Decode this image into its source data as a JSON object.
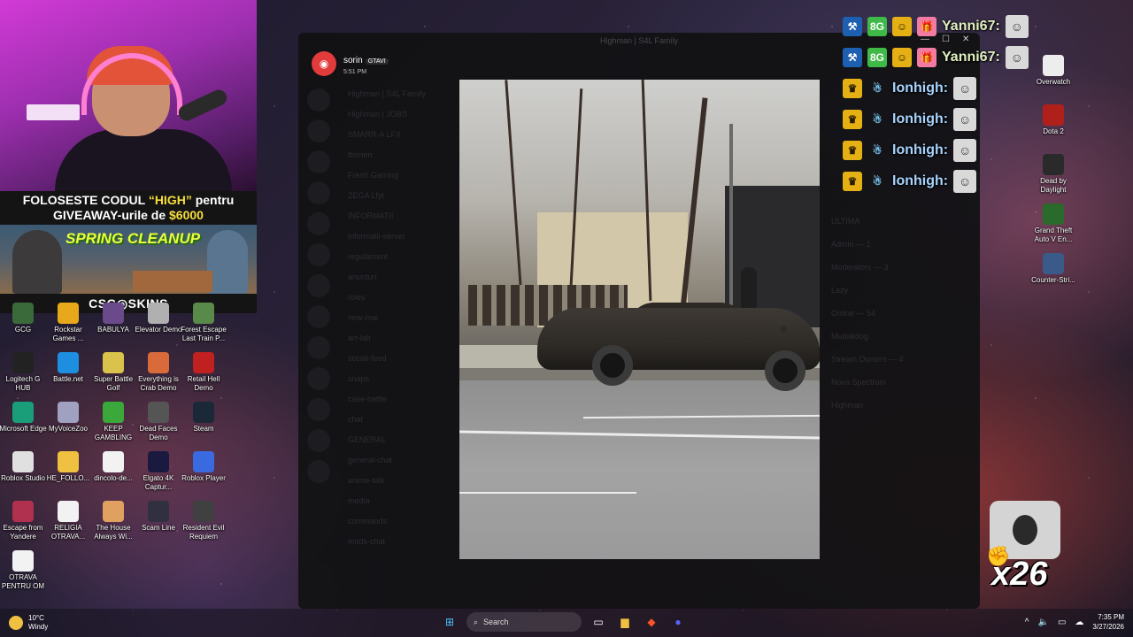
{
  "stream": {
    "promo_line1_a": "FOLOSESTE CODUL ",
    "promo_code": "“HIGH”",
    "promo_line1_b": " pentru",
    "promo_line2_a": "GIVEAWAY-urile de ",
    "promo_amount": "$6000",
    "game_banner": "SPRING CLEANUP",
    "sponsor": "CSG◎SKINS"
  },
  "desktop_left": [
    {
      "label": "GCG",
      "icon": "app-icon",
      "color": "#3a6a3a"
    },
    {
      "label": "Rockstar Games ...",
      "icon": "rockstar-icon",
      "color": "#e8a81b"
    },
    {
      "label": "BABULYA",
      "icon": "app-icon",
      "color": "#6a4a8a"
    },
    {
      "label": "Elevator Demo",
      "icon": "game-icon",
      "color": "#b0b0b0"
    },
    {
      "label": "Forest Escape Last Train P...",
      "icon": "game-icon",
      "color": "#5a8a4a"
    },
    {
      "label": "Logitech G HUB",
      "icon": "logitech-icon",
      "color": "#222222"
    },
    {
      "label": "Battle.net",
      "icon": "battlenet-icon",
      "color": "#1e8ee0"
    },
    {
      "label": "Super Battle Golf",
      "icon": "game-icon",
      "color": "#d9c34a"
    },
    {
      "label": "Everything is Crab Demo",
      "icon": "game-icon",
      "color": "#d96a3a"
    },
    {
      "label": "Retail Hell Demo",
      "icon": "game-icon",
      "color": "#c02020"
    },
    {
      "label": "Microsoft Edge",
      "icon": "edge-icon",
      "color": "#1a9e7a"
    },
    {
      "label": "MyVoiceZoo",
      "icon": "app-icon",
      "color": "#a0a0c0"
    },
    {
      "label": "KEEP GAMBLING",
      "icon": "dollar-icon",
      "color": "#3aa83a"
    },
    {
      "label": "Dead Faces Demo",
      "icon": "game-icon",
      "color": "#555555"
    },
    {
      "label": "Steam",
      "icon": "steam-icon",
      "color": "#1b2838"
    },
    {
      "label": "Roblox Studio",
      "icon": "roblox-icon",
      "color": "#e0e0e0"
    },
    {
      "label": "HE_FOLLO...",
      "icon": "folder-icon",
      "color": "#f0c040"
    },
    {
      "label": "dincolo-de...",
      "icon": "document-icon",
      "color": "#f2f2f2"
    },
    {
      "label": "Elgato 4K Captur...",
      "icon": "elgato-icon",
      "color": "#1a1a40"
    },
    {
      "label": "Roblox Player",
      "icon": "roblox-icon",
      "color": "#3a6ae0"
    },
    {
      "label": "Escape from Yandere",
      "icon": "game-icon",
      "color": "#b03050"
    },
    {
      "label": "RELIGIA OTRAVA...",
      "icon": "document-icon",
      "color": "#f2f2f2"
    },
    {
      "label": "The House Always Wi...",
      "icon": "game-icon",
      "color": "#e0a060"
    },
    {
      "label": "Scam Line",
      "icon": "game-icon",
      "color": "#303040"
    },
    {
      "label": "Resident Evil Requiem",
      "icon": "game-icon",
      "color": "#404040"
    },
    {
      "label": "OTRAVA PENTRU OM",
      "icon": "document-icon",
      "color": "#f2f2f2"
    }
  ],
  "desktop_right": [
    {
      "label": "Overwatch",
      "icon": "overwatch-icon",
      "color": "#ededed"
    },
    {
      "label": "Dota 2",
      "icon": "dota-icon",
      "color": "#b0201a"
    },
    {
      "label": "Dead by Daylight",
      "icon": "game-icon",
      "color": "#2a2a2a"
    },
    {
      "label": "Grand Theft Auto V En...",
      "icon": "gta-icon",
      "color": "#2a6a2a"
    },
    {
      "label": "Counter-Stri...",
      "icon": "cs-icon",
      "color": "#3a5a8a"
    }
  ],
  "discord": {
    "window_title": "Highman | S4L Family",
    "author": "sorin",
    "author_tag": "GTAVI",
    "time": "5:51 PM",
    "channels": [
      "Highman | S4L Family",
      "Highman | JOBS",
      "SMARR-A LFX",
      "ttomen",
      "Fresh Gaming",
      "ZEGA Lfyt",
      "INFORMATII",
      "informatii-server",
      "regulament",
      "anunturi",
      "roles",
      "new-mai",
      "art-lab",
      "social-feed",
      "snaps",
      "case-battle",
      "chat",
      "GENERAL",
      "general-chat",
      "anime-talk",
      "media",
      "commands",
      "mods-chat"
    ],
    "right_panel": [
      "ULTIMA",
      "Admin — 1",
      "Moderators — 3",
      "Lazy",
      "Online — 54",
      "Mudakdog",
      "Stream Owners — 4",
      "Nova Spectrum",
      "Highman"
    ]
  },
  "chat": [
    {
      "name": "Yanni67:",
      "badges": [
        "hammer-icon",
        "8G-badge",
        "smiley-icon",
        "gift-icon"
      ],
      "name_color": "#e0f0c0"
    },
    {
      "name": "Yanni67:",
      "badges": [
        "hammer-icon",
        "8G-badge",
        "smiley-icon",
        "gift-icon"
      ],
      "name_color": "#e0f0c0"
    },
    {
      "name": "Ionhigh:",
      "badges": [
        "crown-icon",
        "ghost-icon"
      ],
      "name_color": "#a8d4ff"
    },
    {
      "name": "Ionhigh:",
      "badges": [
        "crown-icon",
        "ghost-icon"
      ],
      "name_color": "#a8d4ff"
    },
    {
      "name": "Ionhigh:",
      "badges": [
        "crown-icon",
        "ghost-icon"
      ],
      "name_color": "#a8d4ff"
    },
    {
      "name": "Ionhigh:",
      "badges": [
        "crown-icon",
        "ghost-icon"
      ],
      "name_color": "#a8d4ff"
    }
  ],
  "combo": {
    "count": "x26"
  },
  "taskbar": {
    "temperature": "10°C",
    "weather": "Windy",
    "search_placeholder": "Search",
    "time": "7:35 PM",
    "date": "3/27/2026"
  }
}
